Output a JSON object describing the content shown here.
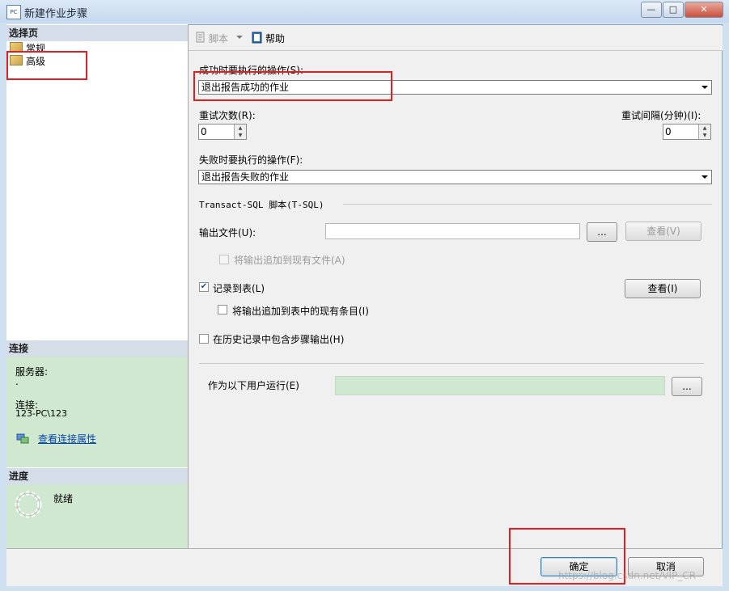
{
  "window": {
    "title": "新建作业步骤",
    "icon_text": "PC",
    "minimize": "—",
    "maximize": "□",
    "close": "✕"
  },
  "sidebar": {
    "select_page_header": "选择页",
    "items": [
      {
        "label": "常规"
      },
      {
        "label": "高级"
      }
    ],
    "connection_header": "连接",
    "server_label": "服务器:",
    "server_value": ".",
    "connection_label": "连接:",
    "connection_value": "123-PC\\123",
    "view_connection_link": "查看连接属性",
    "progress_header": "进度",
    "progress_status": "就绪"
  },
  "toolbar": {
    "script_label": "脚本",
    "help_label": "帮助"
  },
  "form": {
    "on_success_label": "成功时要执行的操作(S):",
    "on_success_value": "退出报告成功的作业",
    "retry_count_label": "重试次数(R):",
    "retry_count_value": "0",
    "retry_interval_label": "重试间隔(分钟)(I):",
    "retry_interval_value": "0",
    "on_failure_label": "失败时要执行的操作(F):",
    "on_failure_value": "退出报告失败的作业",
    "tsql_group_label": "Transact-SQL 脚本(T-SQL)",
    "output_file_label": "输出文件(U):",
    "output_file_value": "",
    "browse_label": "...",
    "view_file_label": "查看(V)",
    "append_to_file_label": "将输出追加到现有文件(A)",
    "append_to_file_checked": false,
    "log_to_table_label": "记录到表(L)",
    "log_to_table_checked": true,
    "view_table_label": "查看(I)",
    "append_to_table_label": "将输出追加到表中的现有条目(I)",
    "append_to_table_checked": false,
    "include_history_label": "在历史记录中包含步骤输出(H)",
    "include_history_checked": false,
    "run_as_label": "作为以下用户运行(E)",
    "run_as_value": "",
    "run_as_browse_label": "..."
  },
  "footer": {
    "ok_label": "确定",
    "cancel_label": "取消",
    "watermark": "https://blog.csdn.net/VIP_CR"
  },
  "colors": {
    "annotation_red": "#e02020",
    "panel_green": "#cfe8cf",
    "run_as_field": "#cfe8cf"
  }
}
